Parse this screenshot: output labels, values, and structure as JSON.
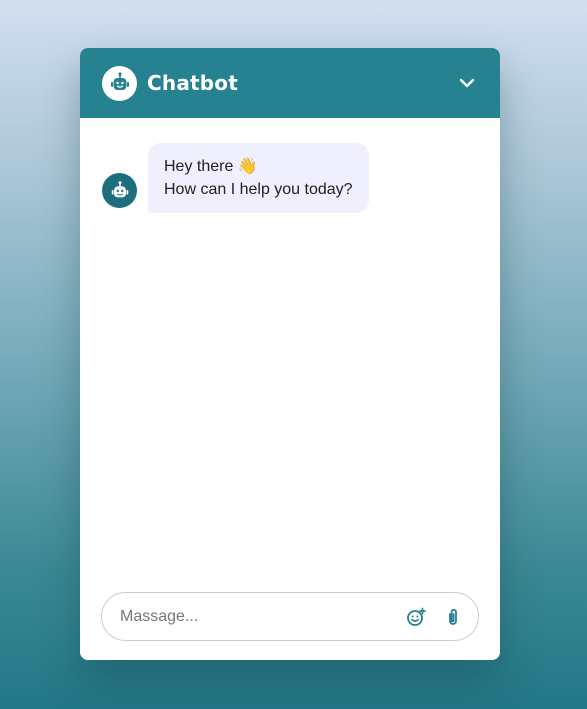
{
  "header": {
    "title": "Chatbot",
    "avatar_icon": "robot-icon",
    "collapse_icon": "chevron-down-icon"
  },
  "messages": [
    {
      "sender": "bot",
      "avatar_icon": "robot-icon",
      "lines": [
        "Hey there 👋",
        "How can I help you today?"
      ]
    }
  ],
  "composer": {
    "placeholder": "Massage...",
    "emoji_icon": "emoji-icon",
    "attach_icon": "paperclip-icon"
  },
  "colors": {
    "accent": "#268290",
    "avatar_bg": "#1e6f7e",
    "bubble_bg": "#efeffd"
  }
}
